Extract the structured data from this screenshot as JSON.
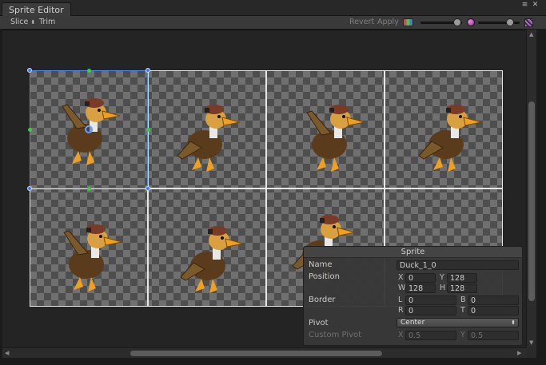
{
  "window": {
    "tab_title": "Sprite Editor",
    "menu_glyph": "≡",
    "close_glyph": "✕"
  },
  "toolbar": {
    "slice_label": "Slice",
    "slice_glyph": "⬍",
    "trim_label": "Trim",
    "revert_label": "Revert",
    "apply_label": "Apply",
    "zoom_level": 0.9,
    "mip_level": 0.75
  },
  "grid": {
    "columns": 4,
    "rows": 2,
    "selected_cell": 0,
    "sprite_count": 7
  },
  "sprite_panel": {
    "title": "Sprite",
    "name_label": "Name",
    "name_value": "Duck_1_0",
    "position_label": "Position",
    "x_label": "X",
    "x_value": "0",
    "y_label": "Y",
    "y_value": "128",
    "w_label": "W",
    "w_value": "128",
    "h_label": "H",
    "h_value": "128",
    "border_label": "Border",
    "l_label": "L",
    "l_value": "0",
    "b_label": "B",
    "b_value": "0",
    "r_label": "R",
    "r_value": "0",
    "t_label": "T",
    "t_value": "0",
    "pivot_label": "Pivot",
    "pivot_value": "Center",
    "custom_pivot_label": "Custom Pivot",
    "cpx_label": "X",
    "cpx_value": "0.5",
    "cpy_label": "Y",
    "cpy_value": "0.5"
  },
  "colors": {
    "selection": "#4a8af0",
    "edge_handle": "#37d03c",
    "duck_body": "#5a3b1c",
    "duck_bill": "#f0a020"
  },
  "icons": {
    "scroll_up": "▲",
    "scroll_down": "▼",
    "scroll_left": "◀",
    "scroll_right": "▶",
    "dropdown": "⬍"
  }
}
